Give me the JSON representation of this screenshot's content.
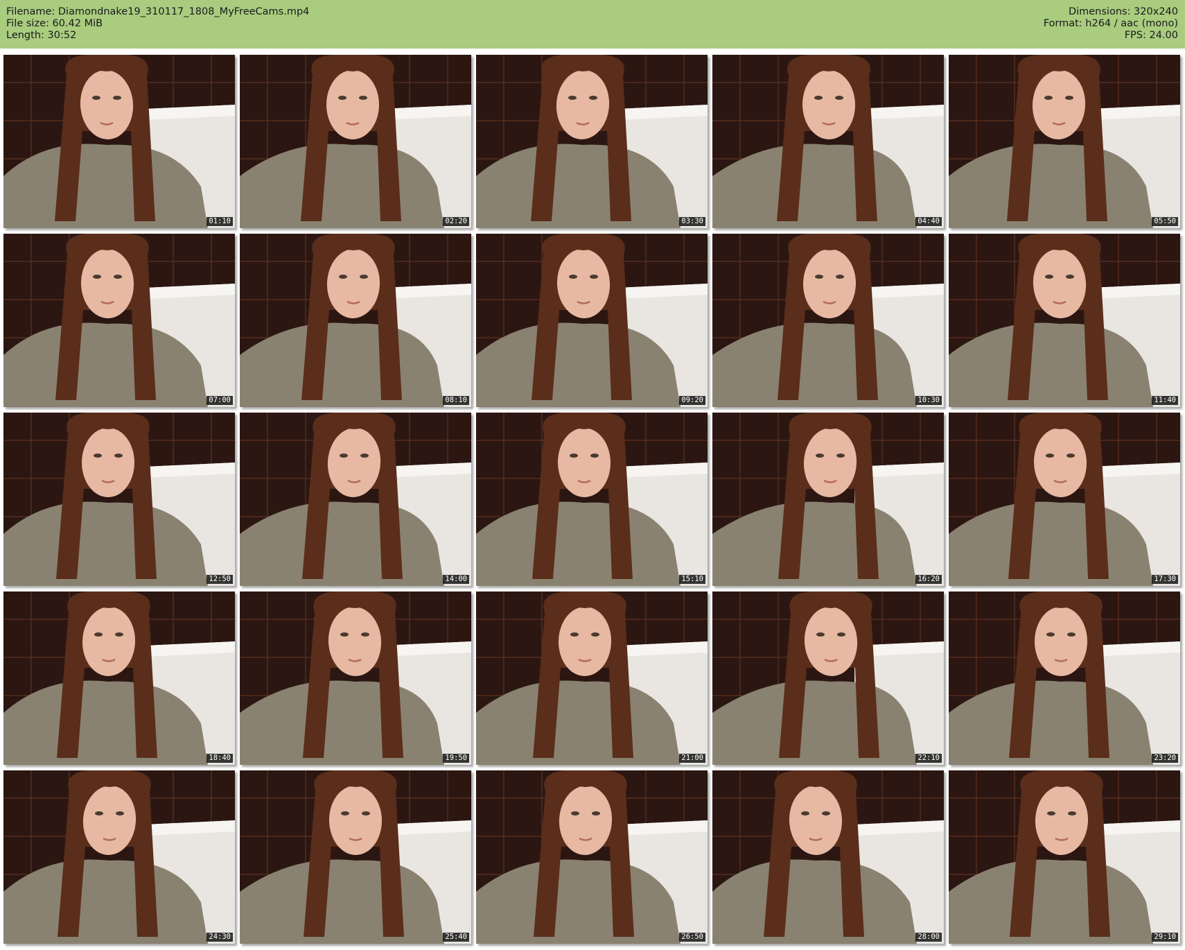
{
  "header": {
    "filename_label": "Filename: Diamondnake19_310117_1808_MyFreeCams.mp4",
    "filesize_label": "File size: 60.42 MiB",
    "length_label": "Length: 30:52",
    "dimensions_label": "Dimensions: 320x240",
    "format_label": "Format: h264 / aac (mono)",
    "fps_label": "FPS: 24.00",
    "background_color": "#a9cc7f"
  },
  "thumbnails": [
    {
      "timestamp": "01:10"
    },
    {
      "timestamp": "02:20"
    },
    {
      "timestamp": "03:30"
    },
    {
      "timestamp": "04:40"
    },
    {
      "timestamp": "05:50"
    },
    {
      "timestamp": "07:00"
    },
    {
      "timestamp": "08:10"
    },
    {
      "timestamp": "09:20"
    },
    {
      "timestamp": "10:30"
    },
    {
      "timestamp": "11:40"
    },
    {
      "timestamp": "12:50"
    },
    {
      "timestamp": "14:00"
    },
    {
      "timestamp": "15:10"
    },
    {
      "timestamp": "16:20"
    },
    {
      "timestamp": "17:30"
    },
    {
      "timestamp": "18:40"
    },
    {
      "timestamp": "19:50"
    },
    {
      "timestamp": "21:00"
    },
    {
      "timestamp": "22:10"
    },
    {
      "timestamp": "23:20"
    },
    {
      "timestamp": "24:30"
    },
    {
      "timestamp": "25:40"
    },
    {
      "timestamp": "26:50"
    },
    {
      "timestamp": "28:00"
    },
    {
      "timestamp": "29:10"
    }
  ],
  "colors": {
    "tile_wall": "#2b1612",
    "tile_grout": "#6b3a24",
    "tub": "#e9e6e2",
    "sweater": "#8a8270",
    "hair": "#5a2e1a",
    "skin": "#e7b9a3"
  }
}
